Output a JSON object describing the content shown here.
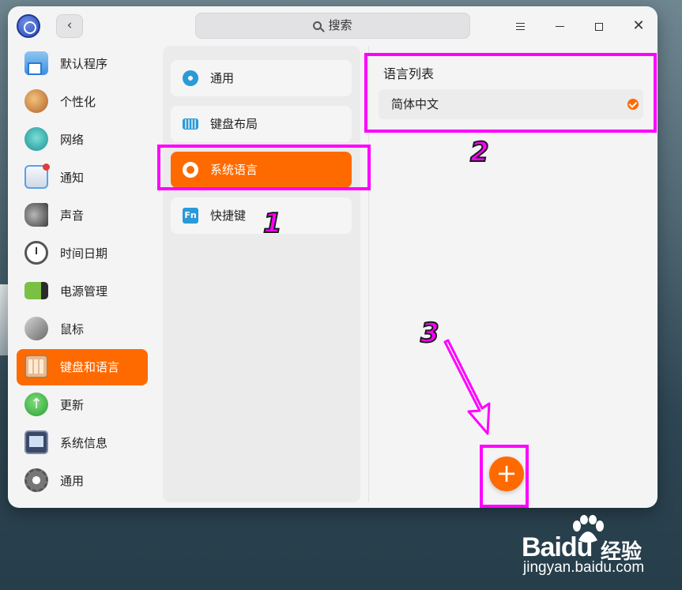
{
  "titlebar": {
    "back_label": "‹",
    "search_placeholder": "搜索",
    "menu_icon": "hamburger-menu-icon",
    "minimize_icon": "minimize-icon",
    "maximize_icon": "maximize-icon",
    "close_label": "✕"
  },
  "sidebar": {
    "items": [
      {
        "label": "默认程序",
        "icon": "default-apps-icon"
      },
      {
        "label": "个性化",
        "icon": "personalization-icon"
      },
      {
        "label": "网络",
        "icon": "network-icon"
      },
      {
        "label": "通知",
        "icon": "notification-icon"
      },
      {
        "label": "声音",
        "icon": "sound-icon"
      },
      {
        "label": "时间日期",
        "icon": "clock-icon"
      },
      {
        "label": "电源管理",
        "icon": "battery-icon"
      },
      {
        "label": "鼠标",
        "icon": "mouse-icon"
      },
      {
        "label": "键盘和语言",
        "icon": "keyboard-icon",
        "active": true
      },
      {
        "label": "更新",
        "icon": "update-icon"
      },
      {
        "label": "系统信息",
        "icon": "system-info-icon"
      },
      {
        "label": "通用",
        "icon": "general-settings-icon"
      }
    ]
  },
  "submenu": {
    "items": [
      {
        "label": "通用",
        "icon": "gear-icon"
      },
      {
        "label": "键盘布局",
        "icon": "keyboard-icon"
      },
      {
        "label": "系统语言",
        "icon": "globe-icon",
        "active": true
      },
      {
        "label": "快捷键",
        "icon": "fn-key-icon",
        "icon_text": "Fn"
      }
    ]
  },
  "language_panel": {
    "title": "语言列表",
    "languages": [
      {
        "name": "简体中文",
        "selected": true
      }
    ],
    "add_label": "+"
  },
  "annotations": {
    "step1": "1",
    "step2": "2",
    "step3": "3",
    "highlight_color": "#ff00ff"
  },
  "watermark": {
    "brand": "Baidu",
    "brand_cn": "经验",
    "url": "jingyan.baidu.com"
  },
  "colors": {
    "accent": "#ff6a00",
    "window_bg": "#f4f4f5"
  }
}
